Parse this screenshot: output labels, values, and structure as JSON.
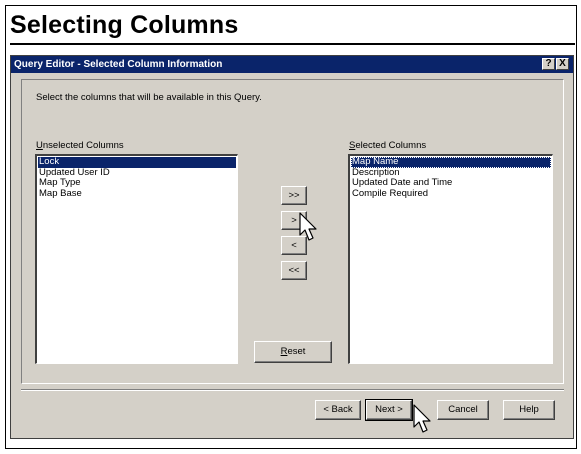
{
  "slide": {
    "title": "Selecting Columns"
  },
  "dialog": {
    "title": "Query Editor - Selected Column Information",
    "help_label": "?",
    "close_label": "X",
    "instructions": "Select the columns that will be available in this Query.",
    "unselected": {
      "label_mnemonic": "U",
      "label_rest": "nselected Columns",
      "items": [
        "Lock",
        "Updated User ID",
        "Map Type",
        "Map Base"
      ],
      "selected_index": 0
    },
    "selected": {
      "label_mnemonic": "S",
      "label_rest": "elected Columns",
      "items": [
        "Map Name",
        "Description",
        "Updated Date and Time",
        "Compile Required"
      ],
      "selected_index": 0
    },
    "move_buttons": {
      "add_all": ">>",
      "add": ">",
      "remove": "<",
      "remove_all": "<<"
    },
    "reset": {
      "mnemonic": "R",
      "rest": "eset"
    },
    "footer": {
      "back": "< Back",
      "next": "Next >",
      "cancel": "Cancel",
      "help": "Help"
    }
  },
  "colors": {
    "titlebar": "#0a246a",
    "face": "#d4d0c8",
    "selection": "#0a246a"
  }
}
